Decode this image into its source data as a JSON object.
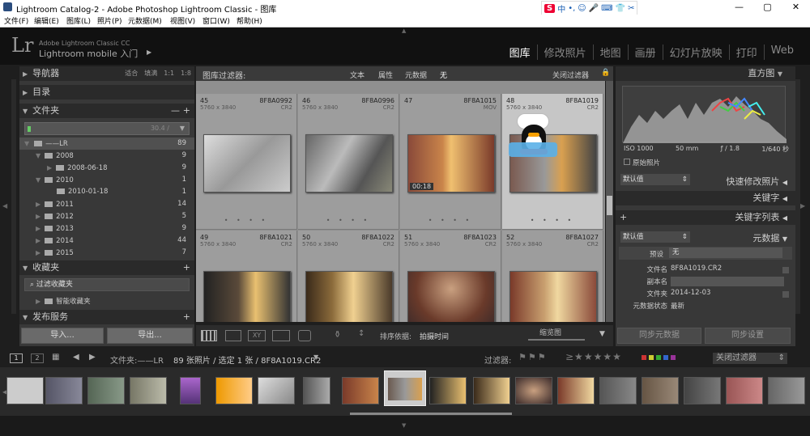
{
  "window": {
    "title": "Lightroom Catalog-2 - Adobe Photoshop Lightroom Classic - 图库"
  },
  "menu": [
    "文件(F)",
    "编辑(E)",
    "图库(L)",
    "照片(P)",
    "元数据(M)",
    "视图(V)",
    "窗口(W)",
    "帮助(H)"
  ],
  "ime": {
    "logo": "S",
    "lang": "中"
  },
  "identity": {
    "logo": "Lr",
    "line1": "Adobe Lightroom Classic CC",
    "line2": "Lightroom mobile 入门"
  },
  "modules": [
    "图库",
    "修改照片",
    "地图",
    "画册",
    "幻灯片放映",
    "打印",
    "Web"
  ],
  "left": {
    "navigator": "导航器",
    "nav_opts": [
      "适合",
      "填满",
      "1:1",
      "1:8"
    ],
    "catalog": "目录",
    "folders": "文件夹",
    "volume_count": "30.4 / ",
    "folder_rows": [
      {
        "name": "——LR",
        "count": "89"
      },
      {
        "name": "2008",
        "count": "9"
      },
      {
        "name": "2008-06-18",
        "count": "9"
      },
      {
        "name": "2010",
        "count": "1"
      },
      {
        "name": "2010-01-18",
        "count": "1"
      },
      {
        "name": "2011",
        "count": "14"
      },
      {
        "name": "2012",
        "count": "5"
      },
      {
        "name": "2013",
        "count": "9"
      },
      {
        "name": "2014",
        "count": "44"
      },
      {
        "name": "2015",
        "count": "7"
      }
    ],
    "collections": "收藏夹",
    "filter_collections": "过滤收藏夹",
    "smart_collections": "智能收藏夹",
    "publish": "发布服务",
    "import": "导入...",
    "export": "导出..."
  },
  "filter": {
    "label": "图库过滤器:",
    "opts": [
      "文本",
      "属性",
      "元数据",
      "无"
    ],
    "close": "关闭过滤器"
  },
  "cells": [
    {
      "idx": "45",
      "file": "8F8A0992",
      "dim": "5760 x 3840",
      "ext": "CR2"
    },
    {
      "idx": "46",
      "file": "8F8A0996",
      "dim": "5760 x 3840",
      "ext": "CR2"
    },
    {
      "idx": "47",
      "file": "8F8A1015",
      "dim": "",
      "ext": "MOV",
      "dur": "00:18"
    },
    {
      "idx": "48",
      "file": "8F8A1019",
      "dim": "5760 x 3840",
      "ext": "CR2"
    },
    {
      "idx": "49",
      "file": "8F8A1021",
      "dim": "5760 x 3840",
      "ext": "CR2"
    },
    {
      "idx": "50",
      "file": "8F8A1022",
      "dim": "5760 x 3840",
      "ext": "CR2"
    },
    {
      "idx": "51",
      "file": "8F8A1023",
      "dim": "5760 x 3840",
      "ext": "CR2"
    },
    {
      "idx": "52",
      "file": "8F8A1027",
      "dim": "5760 x 3840",
      "ext": "CR2"
    }
  ],
  "toolbar": {
    "sort_label": "排序依据:",
    "sort_value": "拍摄时间",
    "thumb": "缩览图"
  },
  "right": {
    "histogram": "直方图",
    "iso": "ISO 1000",
    "focal": "50 mm",
    "aperture": "ƒ / 1.8",
    "shutter": "1/640 秒",
    "original": "原始照片",
    "default": "默认值",
    "quick": "快速修改照片",
    "keywording": "关键字",
    "keywordlist": "关键字列表",
    "metadata_default": "默认值",
    "metadata": "元数据",
    "preset_label": "预设",
    "preset_value": "无",
    "fields": [
      {
        "k": "文件名",
        "v": "8F8A1019.CR2"
      },
      {
        "k": "副本名",
        "v": ""
      },
      {
        "k": "文件夹",
        "v": "2014-12-03"
      },
      {
        "k": "元数据状态",
        "v": "最新"
      }
    ],
    "sync_meta": "同步元数据",
    "sync_settings": "同步设置"
  },
  "filmbar": {
    "p1": "1",
    "p2": "2",
    "source": "文件夹:——LR",
    "count": "89 张照片 / 选定 1 张 / 8F8A1019.CR2",
    "filter_label": "过滤器:",
    "filter_off": "关闭过滤器"
  },
  "colors": {
    "accent": "#ffffff",
    "panel": "#383838",
    "grid": "#8f8f8f",
    "selected": "#c6c6c6"
  }
}
